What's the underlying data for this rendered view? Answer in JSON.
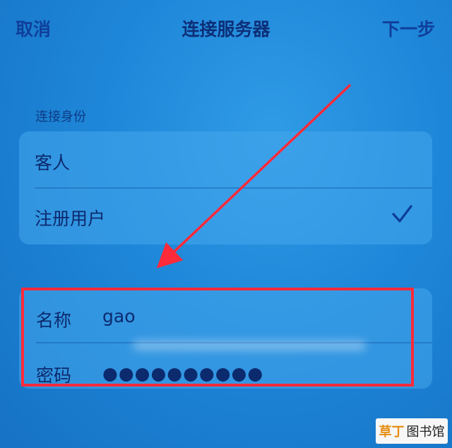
{
  "nav": {
    "cancel": "取消",
    "title": "连接服务器",
    "next": "下一步"
  },
  "identity": {
    "section_label": "连接身份",
    "options": [
      {
        "label": "客人",
        "selected": false
      },
      {
        "label": "注册用户",
        "selected": true
      }
    ]
  },
  "credentials": {
    "name_label": "名称",
    "name_value": "gao",
    "password_label": "密码",
    "password_value": "●●●●●●●●●●"
  },
  "annotation": {
    "highlight_color": "#ff2a3a"
  },
  "watermark": {
    "text_a": "草丁",
    "text_b": "图书馆"
  }
}
